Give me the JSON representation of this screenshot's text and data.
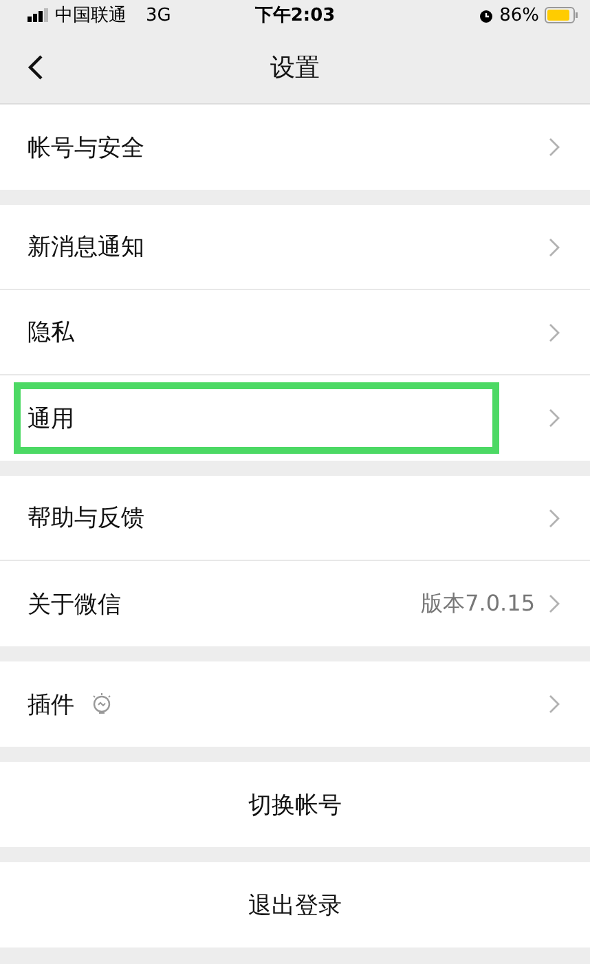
{
  "status_bar": {
    "carrier": "中国联通",
    "network": "3G",
    "time": "下午2:03",
    "battery": "86%"
  },
  "nav": {
    "title": "设置"
  },
  "groups": [
    {
      "items": [
        {
          "label": "帐号与安全",
          "highlighted": false
        }
      ]
    },
    {
      "items": [
        {
          "label": "新消息通知",
          "highlighted": false
        },
        {
          "label": "隐私",
          "highlighted": false
        },
        {
          "label": "通用",
          "highlighted": true
        }
      ]
    },
    {
      "items": [
        {
          "label": "帮助与反馈",
          "highlighted": false
        },
        {
          "label": "关于微信",
          "value": "版本7.0.15",
          "highlighted": false
        }
      ]
    },
    {
      "items": [
        {
          "label": "插件",
          "badge_icon": true,
          "highlighted": false
        }
      ]
    }
  ],
  "actions": [
    {
      "label": "切换帐号"
    },
    {
      "label": "退出登录"
    }
  ]
}
